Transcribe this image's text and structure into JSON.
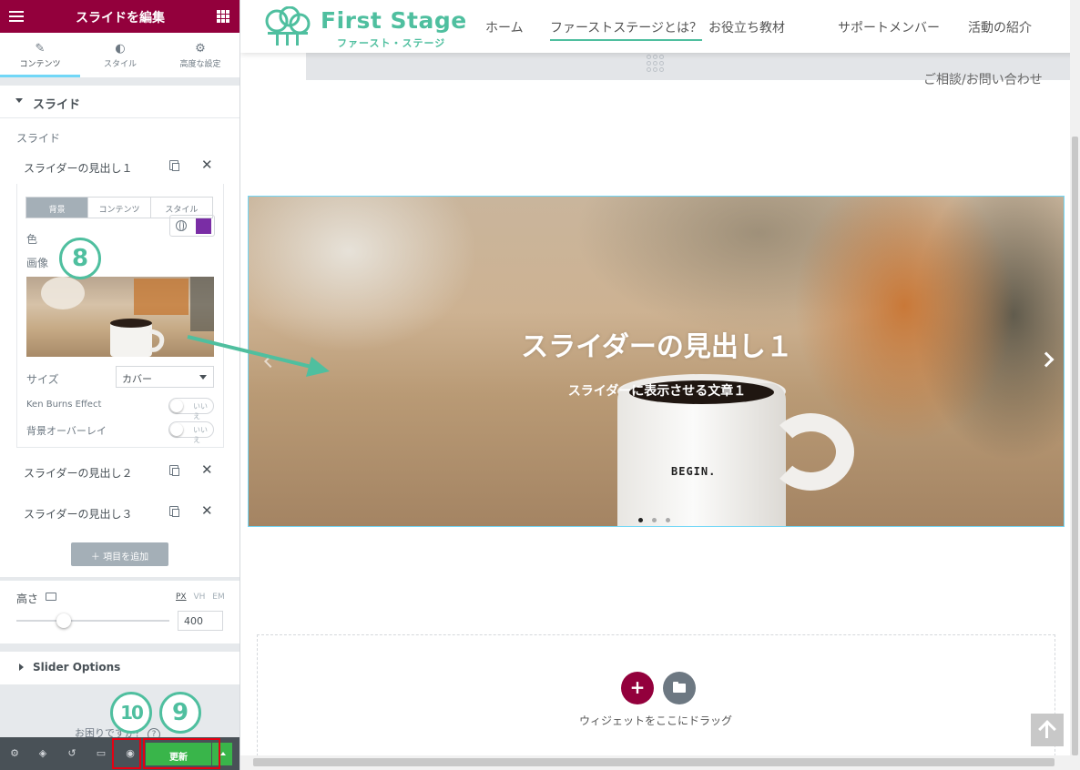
{
  "panel": {
    "title": "スライドを編集",
    "tabs": [
      {
        "label": "コンテンツ",
        "icon": "pencil-icon"
      },
      {
        "label": "スタイル",
        "icon": "contrast-icon"
      },
      {
        "label": "高度な設定",
        "icon": "gear-icon"
      }
    ],
    "section_title": "スライド",
    "slides_label": "スライド",
    "items": [
      {
        "label": "スライダーの見出し１"
      },
      {
        "label": "スライダーの見出し２"
      },
      {
        "label": "スライダーの見出し３"
      }
    ],
    "item_tabs": [
      "背景",
      "コンテンツ",
      "スタイル"
    ],
    "color_label": "色",
    "color_value": "#7a2da5",
    "image_label": "画像",
    "size_label": "サイズ",
    "size_value": "カバー",
    "ken_burns_label": "Ken Burns Effect",
    "overlay_label": "背景オーバーレイ",
    "toggle_off_text": "いいえ",
    "add_item_label": "項目を追加",
    "height_label": "高さ",
    "units": [
      "PX",
      "VH",
      "EM"
    ],
    "height_value": "400",
    "height_slider_level": 0.31,
    "slider_options_label": "Slider Options",
    "help_text": "お困りですか？",
    "update_label": "更新"
  },
  "annotations": {
    "step8": "8",
    "step9": "9",
    "step10": "10",
    "accent_color": "#4fbf9f"
  },
  "site": {
    "logo_text": "First Stage",
    "logo_sub": "ファースト・ステージ",
    "nav": [
      "ホーム",
      "ファーストステージとは？",
      "お役立ち教材",
      "サポートメンバー",
      "活動の紹介"
    ],
    "contact": "ご相談/お問い合わせ"
  },
  "slide": {
    "title": "スライダーの見出し１",
    "description": "スライダーに表示させる文章１",
    "mug_text": "BEGIN.",
    "active_dot": 0
  },
  "dropzone": {
    "text": "ウィジェットをここにドラッグ"
  },
  "colors": {
    "panel_header": "#93003c",
    "update_green": "#39b54a",
    "brand_teal": "#4fbf9f"
  }
}
